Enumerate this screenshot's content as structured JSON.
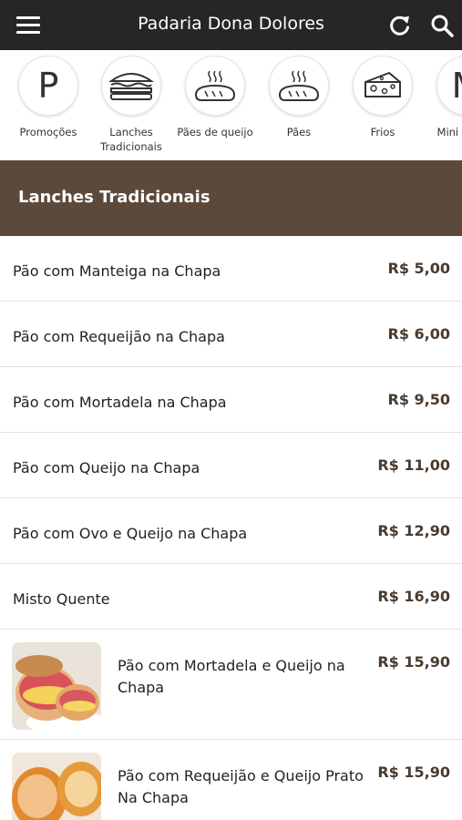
{
  "header": {
    "title": "Padaria Dona Dolores",
    "menu_icon": "hamburger-menu-icon",
    "refresh_icon": "refresh-icon",
    "search_icon": "search-icon"
  },
  "categories": [
    {
      "label": "Promoções",
      "letter": "P",
      "icon": "letter-p-icon"
    },
    {
      "label": "Lanches Tradicionais",
      "icon": "sandwich-icon"
    },
    {
      "label": "Pães de queijo",
      "icon": "bread-steam-icon"
    },
    {
      "label": "Pães",
      "icon": "bread-steam-icon"
    },
    {
      "label": "Frios",
      "icon": "cheese-icon"
    },
    {
      "label": "Mini S... F...",
      "letter": "M",
      "icon": "letter-m-icon"
    }
  ],
  "section": {
    "title": "Lanches Tradicionais"
  },
  "items": [
    {
      "name": "Pão com Manteiga na Chapa",
      "price": "R$ 5,00"
    },
    {
      "name": "Pão com Requeijão na Chapa",
      "price": "R$ 6,00"
    },
    {
      "name": "Pão com Mortadela na Chapa",
      "price": "R$ 9,50"
    },
    {
      "name": "Pão com Queijo na Chapa",
      "price": "R$ 11,00"
    },
    {
      "name": "Pão com Ovo e Queijo na Chapa",
      "price": "R$ 12,90"
    },
    {
      "name": "Misto Quente",
      "price": "R$ 16,90"
    },
    {
      "name": "Pão com Mortadela e Queijo na Chapa",
      "price": "R$ 15,90",
      "image": "mortadela-queijo-photo"
    },
    {
      "name": "Pão com Requeijão e Queijo Prato Na Chapa",
      "price": "R$ 15,90",
      "image": "requeijao-queijo-photo"
    }
  ],
  "colors": {
    "topbar": "#262626",
    "section": "#5b4a3c",
    "price": "#4a3b2e"
  }
}
